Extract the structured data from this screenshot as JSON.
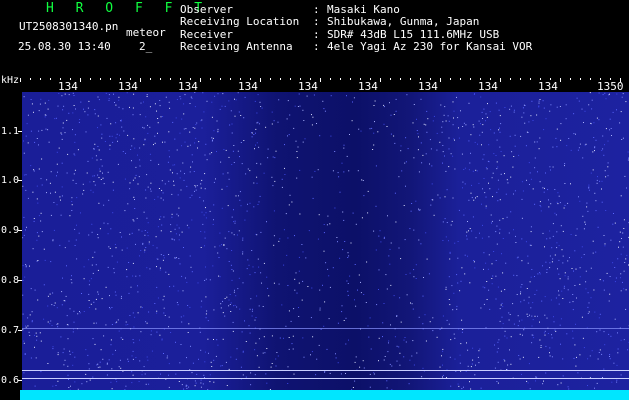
{
  "header": {
    "brand": "H R O F F T",
    "filename": "UT2508301340.pn",
    "mode": "meteor",
    "datetime": "25.08.30 13:40",
    "interval": "2_"
  },
  "info": [
    {
      "key": "Observer",
      "value": "Masaki Kano"
    },
    {
      "key": "Receiving Location",
      "value": "Shibukawa, Gunma, Japan"
    },
    {
      "key": "Receiver",
      "value": "SDR# 43dB L15 111.6MHz USB"
    },
    {
      "key": "Receiving Antenna",
      "value": "4ele Yagi Az 230 for Kansai VOR"
    }
  ],
  "separator": ":",
  "spectrogram": {
    "y_unit": "kHz",
    "x_ticks": [
      "134",
      "134",
      "134",
      "134",
      "134",
      "134",
      "134",
      "134",
      "134",
      "1350"
    ],
    "y_ticks": [
      "1.1",
      "1.0",
      "0.9",
      "0.8",
      "0.7",
      "0.6"
    ],
    "colors": {
      "background": "#1b1f9a",
      "dark_band": "#0c1068",
      "noise": "#5a66ff",
      "cyan": "#00e6ff",
      "line": "#b8c0ff"
    }
  }
}
